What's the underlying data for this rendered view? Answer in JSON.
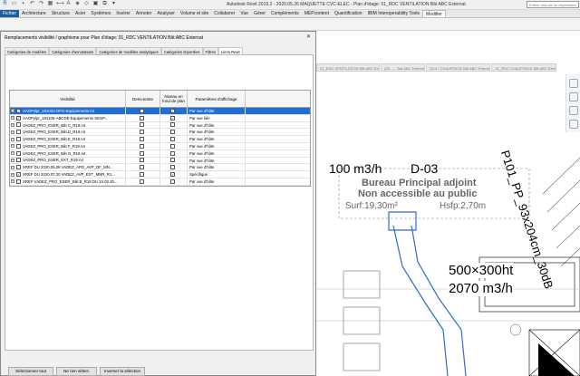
{
  "app": {
    "title": "Autodesk Revit 2019.2 - 2020.05.26 MAQUETTE CVC-ELEC - Plan d'étage: 01_RDC VENTILATION Bât ABC Externat",
    "search_placeholder": "Entrez mot-clé ou expression"
  },
  "ribbon": {
    "tabs": [
      "Fichier",
      "Architecture",
      "Structure",
      "Acier",
      "Systèmes",
      "Insérer",
      "Annoter",
      "Analyser",
      "Volume et site",
      "Collaborer",
      "Vue",
      "Gérer",
      "Compléments",
      "MEPcontent",
      "Quantification",
      "IBIM Interoperability Tools",
      "Modifier"
    ]
  },
  "view_tabs": [
    "01_RDC VENTILATION Bât ABC Ext...",
    "{3D - ... Bât ABC Externat",
    "10 N / CHAUFFAGE Bât ABC Externa...",
    "01_RDC CHAUFFAGE Bât ABC Exter..."
  ],
  "dialog": {
    "title": "Remplacements visibilité / graphisme pour Plan d'étage: 01_RDC VENTILATION Bât ABC Externat",
    "close": "✕",
    "tabs": [
      "Catégories de modèles",
      "Catégories d'annotations",
      "Catégories de modèles analytiques",
      "Catégories importées",
      "Filtres",
      "Liens Revit"
    ],
    "active_tab": 5,
    "columns": [
      "Visibilité",
      "Demi-teinte",
      "Niveau en fond de plan",
      "Paramètres d'affichage"
    ],
    "rows": [
      {
        "name": "AAOPylpr_191022-OFG-Equipements.rvt",
        "visible": true,
        "half": false,
        "underlay": true,
        "display": "Par vue d'hôte",
        "selected": true
      },
      {
        "name": "AAOPylpr_191105-ABCDE-Equipements SEGP...",
        "visible": true,
        "half": false,
        "underlay": true,
        "display": "Par vue liée",
        "selected": false
      },
      {
        "name": "VADEZ_PRO_ESER_Bât C_R19.rvt",
        "visible": false,
        "half": false,
        "underlay": false,
        "display": "Par vue d'hôte",
        "selected": false
      },
      {
        "name": "VADEZ_PRO_ESER_Bât D_R19.rvt",
        "visible": false,
        "half": false,
        "underlay": false,
        "display": "Par vue d'hôte",
        "selected": false
      },
      {
        "name": "VADEZ_PRO_ESER_Bât E_R19.rvt",
        "visible": false,
        "half": false,
        "underlay": false,
        "display": "Par vue d'hôte",
        "selected": false
      },
      {
        "name": "VADEZ_PRO_ESER_Bât F_R19.rvt",
        "visible": false,
        "half": false,
        "underlay": false,
        "display": "Par vue d'hôte",
        "selected": false
      },
      {
        "name": "VADEZ_PRO_ESER_Bât G_R19.rvt",
        "visible": false,
        "half": false,
        "underlay": false,
        "display": "Par vue d'hôte",
        "selected": false
      },
      {
        "name": "VADEZ_PRO_ESER_EXT_R19.rvt",
        "visible": false,
        "half": false,
        "underlay": false,
        "display": "Par vue d'hôte",
        "selected": false
      },
      {
        "name": "XREF DU 2020.05.28 VADEZ_APD_AVP_DF_MN...",
        "visible": false,
        "half": false,
        "underlay": false,
        "display": "Par vue d'hôte",
        "selected": false
      },
      {
        "name": "XREF DU 2020.07.20 VADEZ_AVP_EXT_MNR_R1...",
        "visible": true,
        "half": false,
        "underlay": true,
        "display": "Spécifique",
        "selected": false
      },
      {
        "name": "XREF VADEZ_PRO_ESER_Bât B_R18 DU 24.02.20...",
        "visible": false,
        "half": false,
        "underlay": false,
        "display": "Par vue d'hôte",
        "selected": false
      }
    ],
    "buttons": [
      "Sélectionner tout",
      "Ne rien sélect.",
      "Inverser la sélection"
    ]
  },
  "drawing": {
    "airflow_label": "100 m3/h",
    "room_number": "D-03",
    "room_name_1": "Bureau Principal adjoint",
    "room_name_2": "Non accessible au public",
    "surface": "Surf:19,30m²",
    "height": "Hsfp:2,70m",
    "duct_size": "500×300ht",
    "duct_flow": "2070 m3/h",
    "rotated_label": "P101_PP_93x204cm_30dB"
  }
}
